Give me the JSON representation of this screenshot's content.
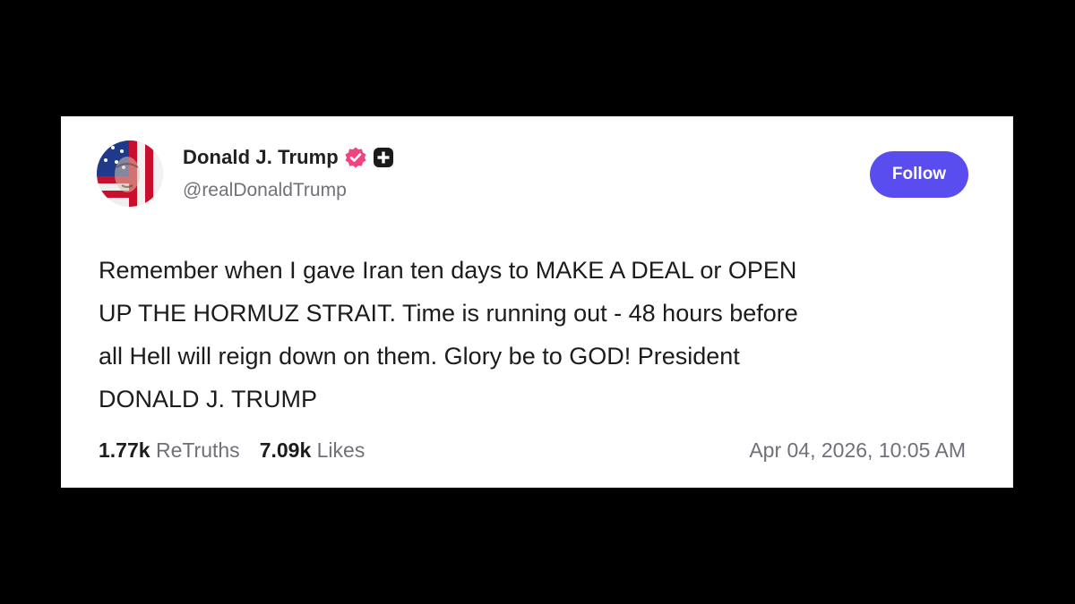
{
  "post": {
    "author": {
      "display_name": "Donald J. Trump",
      "handle": "@realDonaldTrump",
      "verified_icon": "verified-badge-icon",
      "plus_icon": "plus-badge-icon",
      "avatar": "avatar-flag-portrait"
    },
    "follow_label": "Follow",
    "body_lines": [
      "Remember when I gave Iran ten days to MAKE A DEAL or OPEN",
      "UP THE HORMUZ STRAIT. Time is running out - 48 hours before",
      "all Hell will reign down on them. Glory be to GOD! President",
      "DONALD J. TRUMP"
    ],
    "stats": {
      "retruths_count": "1.77k",
      "retruths_label": "ReTruths",
      "likes_count": "7.09k",
      "likes_label": "Likes"
    },
    "timestamp": "Apr 04, 2026, 10:05 AM"
  },
  "colors": {
    "background": "#000000",
    "card": "#ffffff",
    "accent": "#5a4df0",
    "verified": "#f0447f",
    "text_primary": "#1c1c1c",
    "text_secondary": "#6f7177"
  }
}
